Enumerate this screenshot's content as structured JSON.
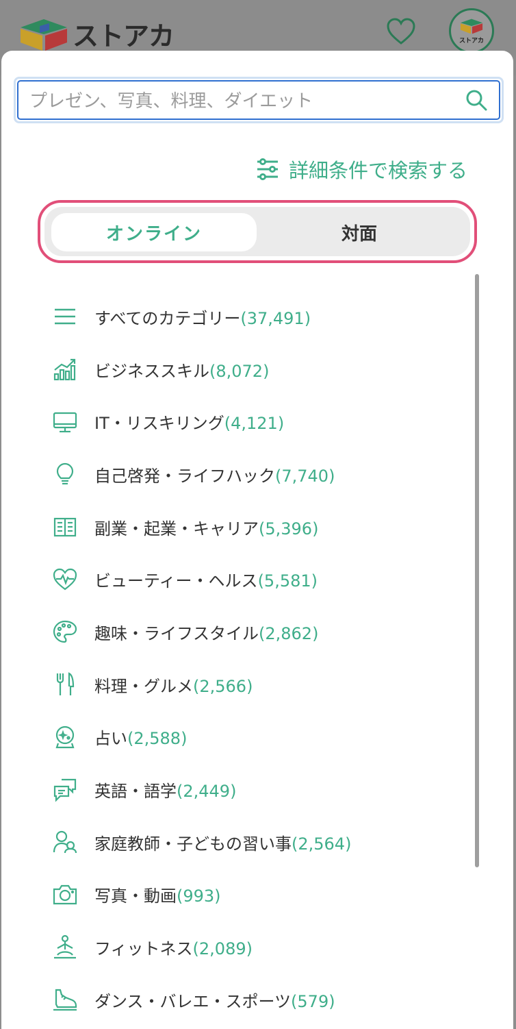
{
  "header": {
    "logo_text": "ストアカ",
    "avatar_text": "ストアカ"
  },
  "search": {
    "placeholder": "プレゼン、写真、料理、ダイエット",
    "value": ""
  },
  "detail_search_label": "詳細条件で検索する",
  "tabs": {
    "online": "オンライン",
    "offline": "対面",
    "selected": "オンライン"
  },
  "colors": {
    "accent": "#3fae8a",
    "toggle_border": "#e14f79",
    "search_border": "#2f6fd0"
  },
  "categories": [
    {
      "icon": "menu-icon",
      "label": "すべてのカテゴリー",
      "count": "(37,491)"
    },
    {
      "icon": "chart-growth-icon",
      "label": "ビジネススキル",
      "count": "(8,072)"
    },
    {
      "icon": "monitor-icon",
      "label": "IT・リスキリング",
      "count": "(4,121)"
    },
    {
      "icon": "lightbulb-icon",
      "label": "自己啓発・ライフハック",
      "count": "(7,740)"
    },
    {
      "icon": "book-icon",
      "label": "副業・起業・キャリア",
      "count": "(5,396)"
    },
    {
      "icon": "heartbeat-icon",
      "label": "ビューティー・ヘルス",
      "count": "(5,581)"
    },
    {
      "icon": "palette-icon",
      "label": "趣味・ライフスタイル",
      "count": "(2,862)"
    },
    {
      "icon": "fork-knife-icon",
      "label": "料理・グルメ",
      "count": "(2,566)"
    },
    {
      "icon": "crystal-ball-icon",
      "label": "占い",
      "count": "(2,588)"
    },
    {
      "icon": "chat-icon",
      "label": "英語・語学",
      "count": "(2,449)"
    },
    {
      "icon": "tutor-icon",
      "label": "家庭教師・子どもの習い事",
      "count": "(2,564)"
    },
    {
      "icon": "camera-icon",
      "label": "写真・動画",
      "count": "(993)"
    },
    {
      "icon": "yoga-icon",
      "label": "フィットネス",
      "count": "(2,089)"
    },
    {
      "icon": "shoe-icon",
      "label": "ダンス・バレエ・スポーツ",
      "count": "(579)"
    }
  ]
}
